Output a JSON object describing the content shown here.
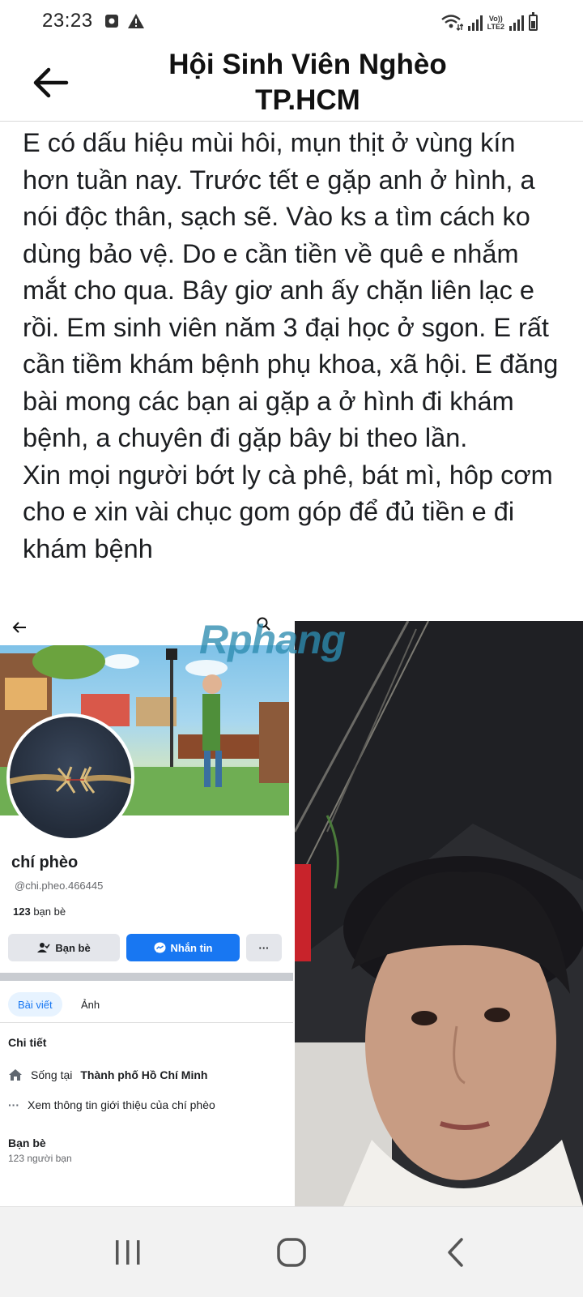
{
  "status_bar": {
    "time": "23:23",
    "volte_line1": "Vo))",
    "volte_line2": "LTE2"
  },
  "header": {
    "title_line1": "Hội Sinh Viên Nghèo",
    "title_line2": "TP.HCM"
  },
  "post": {
    "text": "E có dấu hiệu mùi hôi, mụn thịt ở vùng kín hơn tuần nay. Trước tết e gặp anh ở hình, a nói độc thân, sạch sẽ. Vào ks a tìm cách ko dùng bảo vệ. Do e cần tiền về quê e nhắm mắt cho qua. Bây giơ anh ấy chặn liên lạc e rồi. Em sinh viên năm 3 đại học ở sgon. E rất cần tiềm khám bệnh phụ khoa, xã hội. E đăng bài mong các bạn ai gặp a ở hình đi khám bệnh, a chuyên đi gặp bây bi theo lần.\nXin mọi người bớt ly cà phê, bát mì, hôp cơm cho e xin vài chục gom góp để đủ tiền e đi khám bệnh"
  },
  "watermark": "Rphang",
  "profile_screenshot": {
    "name": "chí phèo",
    "handle": "@chi.pheo.466445",
    "friends_count": "123",
    "friends_label": "bạn bè",
    "friends_button": "Bạn bè",
    "message_button": "Nhắn tin",
    "more_button": "···",
    "tab_posts": "Bài viết",
    "tab_photos": "Ảnh",
    "details_heading": "Chi tiết",
    "lives_in_prefix": "Sống tại",
    "lives_in_city": "Thành phố Hồ Chí Minh",
    "more_ellipsis": "···",
    "see_about": "Xem thông tin giới thiệu của chí phèo",
    "friends_heading": "Bạn bè",
    "friends_total": "123 người bạn"
  },
  "icons": {
    "status_left": [
      "gallery-icon",
      "warning-icon"
    ],
    "status_right": [
      "wifi-icon",
      "signal-icon",
      "signal-icon",
      "battery-icon"
    ],
    "header": "back-arrow-icon",
    "nav": [
      "recent-apps-icon",
      "home-icon",
      "back-icon"
    ]
  },
  "colors": {
    "facebook_blue": "#1877f2",
    "watermark": "#2d8caf"
  }
}
